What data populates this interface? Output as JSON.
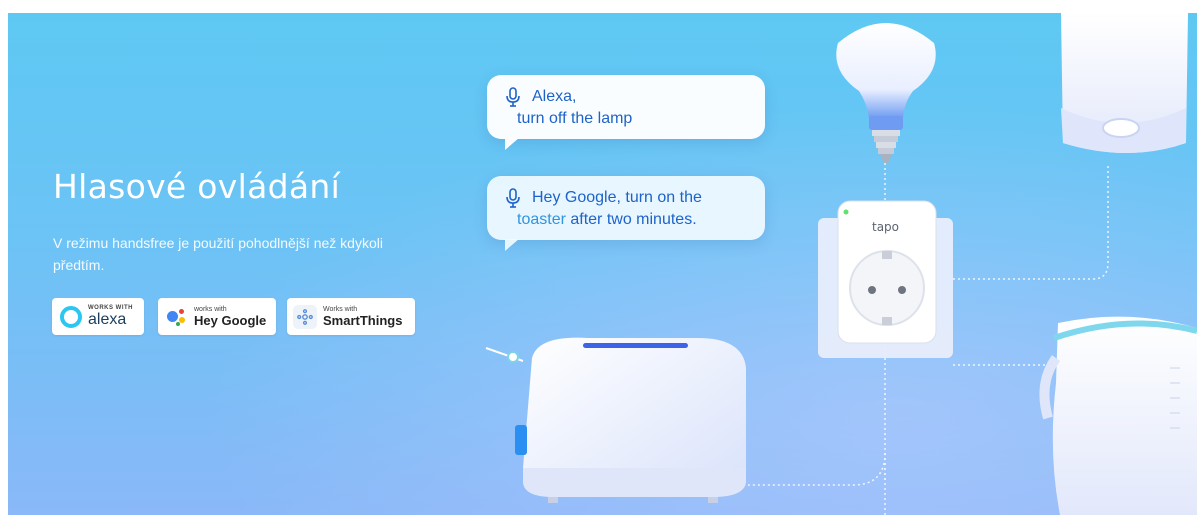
{
  "section": {
    "title": "Hlasové ovládání",
    "description": "V režimu handsfree je použití pohodlnější než kdykoli předtím."
  },
  "badges": {
    "alexa": {
      "works_label": "WORKS WITH",
      "name": "alexa",
      "icon": "alexa-ring-icon"
    },
    "google": {
      "works_label": "works with",
      "name": "Hey Google",
      "icon": "google-assistant-icon"
    },
    "smartthings": {
      "works_label": "Works with",
      "name": "SmartThings",
      "icon": "smartthings-icon"
    }
  },
  "bubbles": {
    "alexa": {
      "line1": "Alexa,",
      "line2": "turn off the lamp"
    },
    "google": {
      "line1_pre": "Hey Google, turn on the",
      "line2_highlight": "toaster",
      "line2_post": " after two minutes."
    }
  },
  "devices": {
    "plug_brand": "tapo",
    "items": [
      "lamp-bulb-icon",
      "smart-plug-icon",
      "toaster-icon",
      "kettle-icon",
      "speaker-icon"
    ]
  },
  "colors": {
    "background_top": "#5ec8f3",
    "background_bottom": "#8ab8f8",
    "bubble_text": "#1e63c9",
    "alexa_blue": "#2bc6f2",
    "google_blue": "#4285F4",
    "google_red": "#EA4335",
    "google_yellow": "#FBBC05",
    "google_green": "#34A853"
  }
}
